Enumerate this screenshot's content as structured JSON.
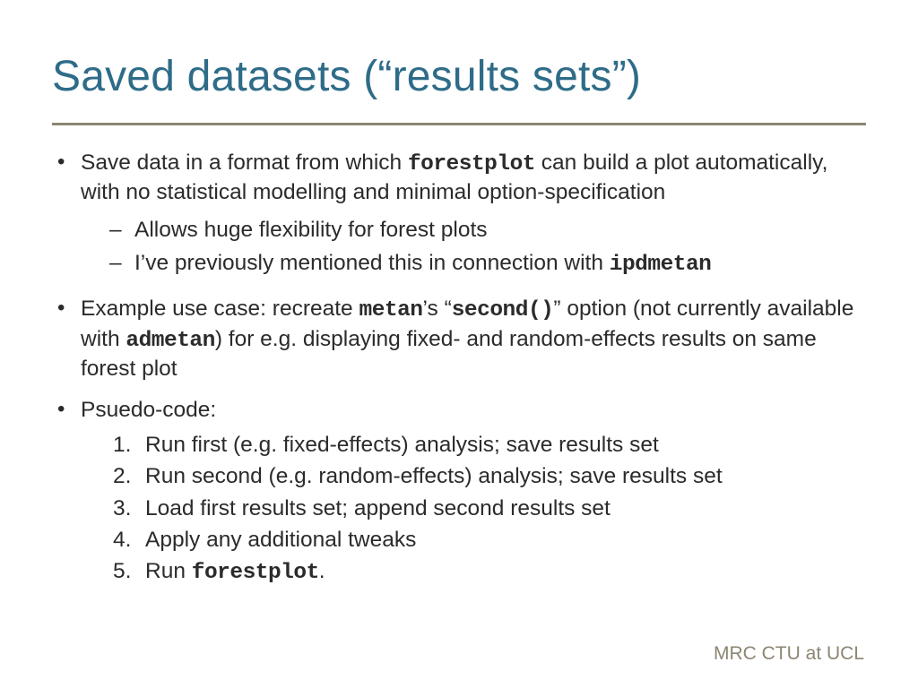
{
  "title": "Saved datasets (“results sets”)",
  "b1_pre": "Save data in a format from which ",
  "b1_code": "forestplot",
  "b1_post": " can build a plot automatically, with no statistical modelling and minimal option-specification",
  "b1_s1": "Allows huge flexibility for forest plots",
  "b1_s2_pre": "I’ve previously mentioned this in connection with ",
  "b1_s2_code": "ipdmetan",
  "b2_pre": "Example use case: recreate ",
  "b2_c1": "metan",
  "b2_mid1": "’s “",
  "b2_c2": "second()",
  "b2_mid2": "” option (not currently available with ",
  "b2_c3": "admetan",
  "b2_post": ") for e.g. displaying fixed- and random-effects results on same forest plot",
  "b3": "Psuedo-code:",
  "s1": "Run first (e.g. fixed-effects) analysis; save results set",
  "s2": "Run second (e.g. random-effects) analysis; save results set",
  "s3": "Load first results set; append second results set",
  "s4": "Apply any additional tweaks",
  "s5_pre": "Run ",
  "s5_code": "forestplot",
  "s5_post": ".",
  "footer": "MRC CTU at UCL"
}
